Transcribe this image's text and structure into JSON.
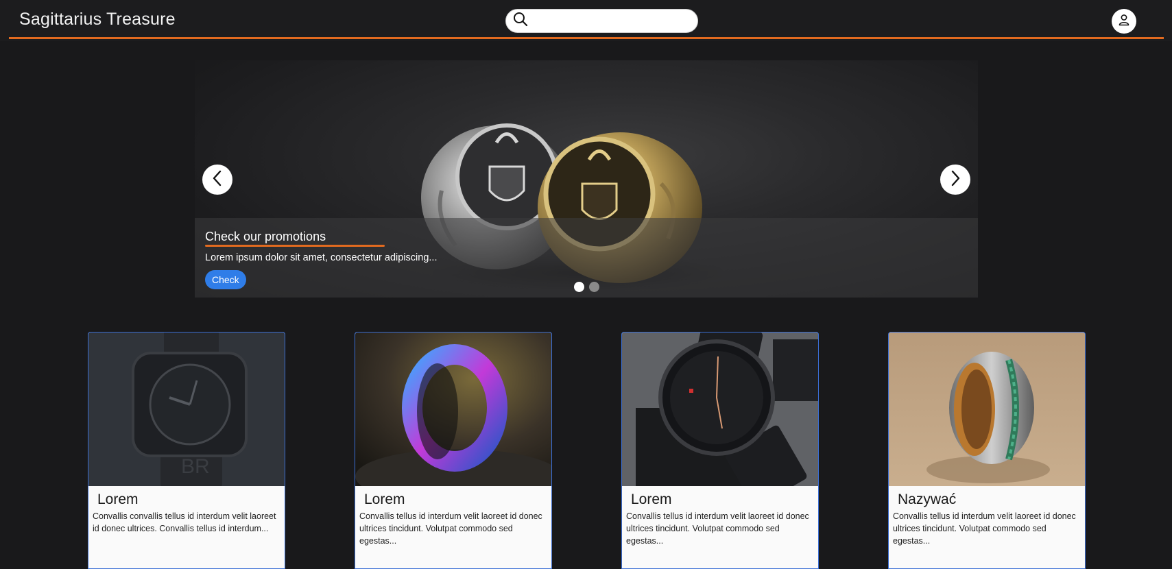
{
  "header": {
    "brand": "Sagittarius Treasure",
    "search": {
      "value": "",
      "placeholder": "",
      "icon": "search-icon"
    },
    "user_icon": "user-icon",
    "accent_color": "#e26a1f"
  },
  "carousel": {
    "caption_title": "Check our promotions",
    "caption_text": "Lorem ipsum dolor sit amet, consectetur adipiscing...",
    "button_label": "Check",
    "button_color": "#2f7de8",
    "prev_icon": "chevron-left-icon",
    "next_icon": "chevron-right-icon",
    "slide_count": 2,
    "active_slide": 1
  },
  "products": [
    {
      "title": "Lorem",
      "text": "Convallis convallis tellus id interdum velit laoreet id donec ultrices. Convallis tellus id interdum..."
    },
    {
      "title": "Lorem",
      "text": "Convallis tellus id interdum velit laoreet id donec ultrices tincidunt. Volutpat commodo sed egestas..."
    },
    {
      "title": "Lorem",
      "text": "Convallis tellus id interdum velit laoreet id donec ultrices tincidunt. Volutpat commodo sed egestas..."
    },
    {
      "title": "Nazywać",
      "text": "Convallis tellus id interdum velit laoreet id donec ultrices tincidunt. Volutpat commodo sed egestas..."
    }
  ]
}
